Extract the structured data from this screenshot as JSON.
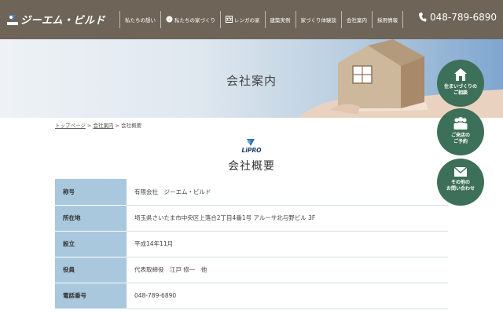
{
  "header": {
    "logo_text": "ジーエム・ビルド",
    "logo_mark_text": "LiPRO",
    "nav": [
      {
        "label": "私たちの想い",
        "icon": ""
      },
      {
        "label": "私たちの家づくり",
        "icon": "lipro-badge-icon"
      },
      {
        "label": "レンガの家",
        "icon": "brick-house-icon"
      },
      {
        "label": "建築実例",
        "icon": ""
      },
      {
        "label": "家づくり体験談",
        "icon": ""
      },
      {
        "label": "会社案内",
        "icon": ""
      },
      {
        "label": "採用情報",
        "icon": ""
      }
    ],
    "phone": "048-789-6890"
  },
  "hero": {
    "title": "会社案内"
  },
  "breadcrumb": {
    "home": "トップページ",
    "sep1": " > ",
    "parent": "会社案内",
    "sep2": " > ",
    "current": "会社概要"
  },
  "section": {
    "logo_text": "LiPRO",
    "title": "会社概要"
  },
  "company_table": [
    {
      "label": "称号",
      "value": "有限会社　ジーエム・ビルド"
    },
    {
      "label": "所在地",
      "value": "埼玉県さいたま市中央区上落合2丁目4番1号 アルーサ北与野ビル 3F"
    },
    {
      "label": "設立",
      "value": "平成14年11月"
    },
    {
      "label": "役員",
      "value": "代表取締役　江戸 修一　他"
    },
    {
      "label": "電話番号",
      "value": "048-789-6890"
    }
  ],
  "floating_buttons": [
    {
      "label": "住まいづくりの\nご相談",
      "icon": "house-icon"
    },
    {
      "label": "ご来店の\nご予約",
      "icon": "people-icon"
    },
    {
      "label": "その他の\nお問い合わせ",
      "icon": "mail-icon"
    }
  ],
  "colors": {
    "header_bg": "#6e6558",
    "table_label_bg": "#a9c7dd",
    "float_btn_bg": "#3d7058",
    "hero_sky": "#7fa6cf"
  }
}
